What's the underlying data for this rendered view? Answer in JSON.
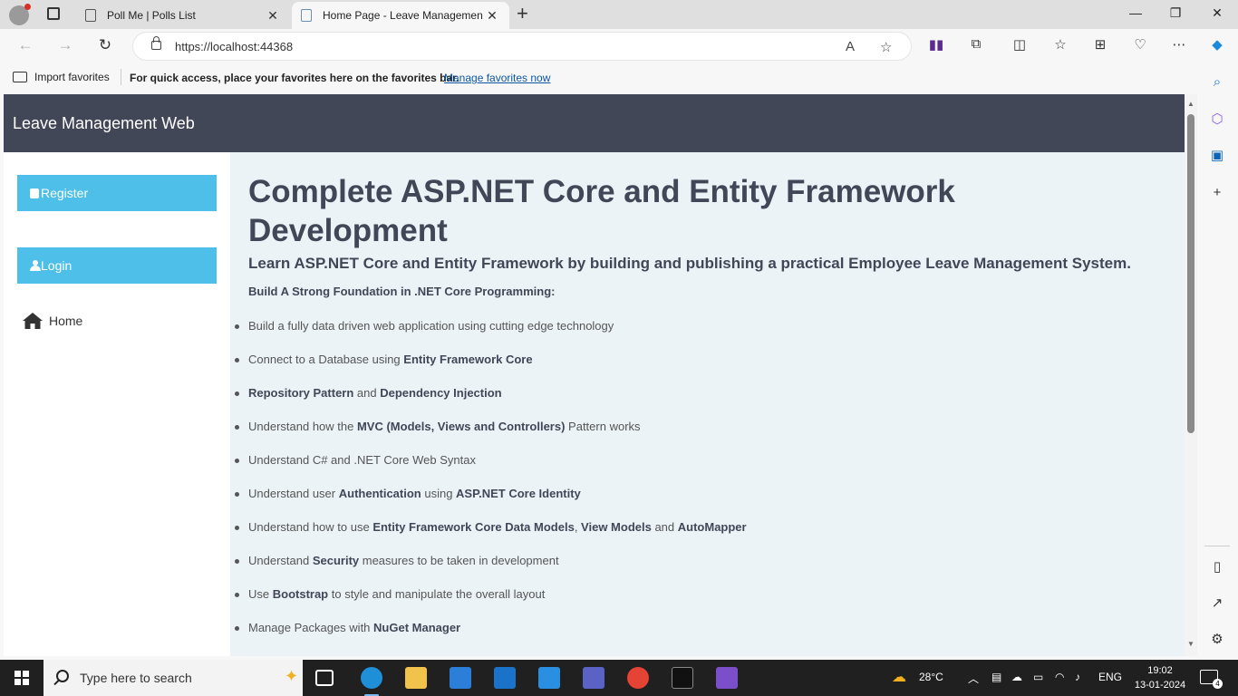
{
  "browser": {
    "tabs": [
      {
        "label": "Poll Me | Polls List",
        "active": false
      },
      {
        "label": "Home Page - Leave Managemen",
        "active": true
      }
    ],
    "url": "https://localhost:44368",
    "favorites_bar": {
      "import_label": "Import favorites",
      "message": "For quick access, place your favorites here on the favorites bar.",
      "manage_link": "Manage favorites now"
    }
  },
  "app": {
    "brand": "Leave Management Web",
    "sidebar": {
      "register_label": "Register",
      "login_label": "Login",
      "home_label": "Home"
    },
    "main": {
      "title": "Complete ASP.NET Core and Entity Framework Development",
      "subtitle": "Learn ASP.NET Core and Entity Framework by building and publishing a practical Employee Leave Management System.",
      "section_heading": "Build A Strong Foundation in .NET Core Programming:",
      "bullets": [
        [
          {
            "t": "Build a fully data driven web application using cutting edge technology",
            "b": false
          }
        ],
        [
          {
            "t": "Connect to a Database using ",
            "b": false
          },
          {
            "t": "Entity Framework Core",
            "b": true
          }
        ],
        [
          {
            "t": "Repository Pattern",
            "b": true
          },
          {
            "t": " and ",
            "b": false
          },
          {
            "t": "Dependency Injection",
            "b": true
          }
        ],
        [
          {
            "t": "Understand how the ",
            "b": false
          },
          {
            "t": "MVC (Models, Views and Controllers)",
            "b": true
          },
          {
            "t": " Pattern works",
            "b": false
          }
        ],
        [
          {
            "t": "Understand C# and .NET Core Web Syntax",
            "b": false
          }
        ],
        [
          {
            "t": "Understand user ",
            "b": false
          },
          {
            "t": "Authentication",
            "b": true
          },
          {
            "t": " using ",
            "b": false
          },
          {
            "t": "ASP.NET Core Identity",
            "b": true
          }
        ],
        [
          {
            "t": "Understand how to use ",
            "b": false
          },
          {
            "t": "Entity Framework Core Data Models",
            "b": true
          },
          {
            "t": ", ",
            "b": false
          },
          {
            "t": "View Models",
            "b": true
          },
          {
            "t": " and ",
            "b": false
          },
          {
            "t": "AutoMapper",
            "b": true
          }
        ],
        [
          {
            "t": "Understand ",
            "b": false
          },
          {
            "t": "Security",
            "b": true
          },
          {
            "t": " measures to be taken in development",
            "b": false
          }
        ],
        [
          {
            "t": "Use ",
            "b": false
          },
          {
            "t": "Bootstrap",
            "b": true
          },
          {
            "t": " to style and manipulate the overall layout",
            "b": false
          }
        ],
        [
          {
            "t": "Manage Packages with ",
            "b": false
          },
          {
            "t": "NuGet Manager",
            "b": true
          }
        ]
      ]
    }
  },
  "taskbar": {
    "search_placeholder": "Type here to search",
    "weather": "28°C",
    "language": "ENG",
    "time": "19:02",
    "date": "13-01-2024",
    "notification_count": "4"
  },
  "colors": {
    "header_bg": "#424757",
    "button_bg": "#4dbfe8",
    "content_bg": "#ebf3f7"
  }
}
